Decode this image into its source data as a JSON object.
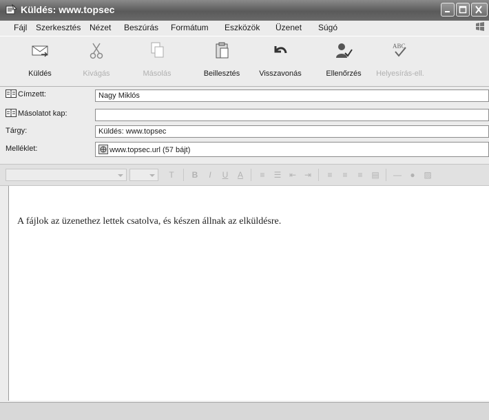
{
  "window": {
    "title": "Küldés: www.topsec"
  },
  "menu": [
    "Fájl",
    "Szerkesztés",
    "Nézet",
    "Beszúrás",
    "Formátum",
    "Eszközök",
    "Üzenet",
    "Súgó"
  ],
  "toolbar": [
    {
      "label": "Küldés",
      "icon": "send-icon",
      "enabled": true
    },
    {
      "label": "Kivágás",
      "icon": "scissors-icon",
      "enabled": false
    },
    {
      "label": "Másolás",
      "icon": "copy-icon",
      "enabled": false
    },
    {
      "label": "Beillesztés",
      "icon": "paste-icon",
      "enabled": true
    },
    {
      "label": "Visszavonás",
      "icon": "undo-icon",
      "enabled": true
    },
    {
      "label": "Ellenőrzés",
      "icon": "check-names-icon",
      "enabled": true
    },
    {
      "label": "Helyesírás-ell.",
      "icon": "spelling-icon",
      "enabled": false
    }
  ],
  "fields": {
    "to": {
      "label": "Címzett:",
      "value": "Nagy Miklós"
    },
    "cc": {
      "label": "Másolatot kap:",
      "value": ""
    },
    "subject": {
      "label": "Tárgy:",
      "value": "Küldés: www.topsec"
    },
    "attachment": {
      "label": "Melléklet:",
      "value": "www.topsec.url (57 bájt)"
    }
  },
  "body": {
    "text": "A fájlok az üzenethez lettek csatolva, és készen állnak az elküldésre."
  }
}
